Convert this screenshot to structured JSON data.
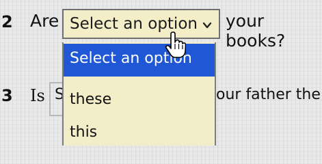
{
  "q2": {
    "number": "2",
    "text_before": "Are",
    "text_after": "your books?",
    "select": {
      "value": "Select an option",
      "icon": "chevron-down-icon"
    },
    "dropdown_options": [
      "Select an option",
      "these",
      "this"
    ],
    "highlighted_option": "Select an option"
  },
  "q3": {
    "number": "3",
    "text_before": "Is",
    "box_partial": "S",
    "text_after": "our father the"
  },
  "colors": {
    "highlight": "#1f57d4",
    "select_bg": "#f3eec8"
  },
  "cursor_icon": "hand-pointer-icon"
}
